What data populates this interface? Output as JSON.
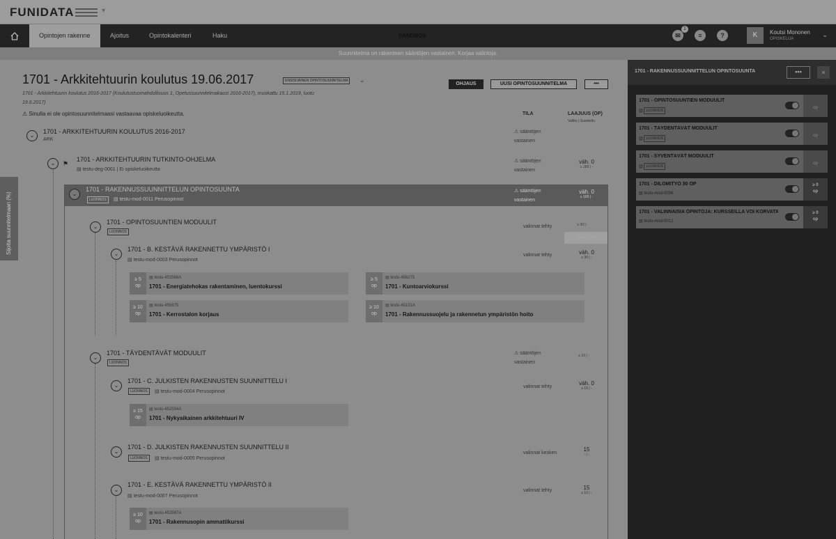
{
  "brand": {
    "logo": "FUNIDATA"
  },
  "nav": {
    "tabs": [
      "Opintojen rakenne",
      "Ajoitus",
      "Opintokalenteri",
      "Haku"
    ],
    "environment": "SANDBOX",
    "notification_count": "1",
    "user": {
      "initial": "K",
      "name": "Koutsi Mononen",
      "role": "OPISKELIJA"
    }
  },
  "notice": "Suunnitelma on rakenteen sääntöjen vastainen. Korjaa valintoja.",
  "plan": {
    "title": "1701 - Arkkitehtuurin koulutus 19.06.2017",
    "primary_tag": "ENSISIJAINEN OPINTOSUUNNITELMA",
    "subtitle": "1701 - Arkkitehtuurin koulutus 2016-2017 (Koulutustuomahdollisuus 1, Opetussuunnitelmakausi 2016-2017), muokattu 15.1.2019, luotu 19.6.2017)",
    "warning": "Sinulla ei ole opintosuunnitelmaasi vastaavaa opiskeluoikeutta.",
    "buttons": {
      "guidance": "OHJAUS",
      "new_plan": "UUSI OPINTOSUUNNITELMA",
      "more": "•••"
    },
    "columns": {
      "status": "TILA",
      "credits": "LAAJUUS (OP)",
      "credits_sub": "Valittu | Suoritettu"
    }
  },
  "tree": {
    "education": {
      "title": "1701 - ARKKITEHTUURIN KOULUTUS 2016-2017",
      "code": "ARK",
      "status": "sääntöjen vastainen"
    },
    "programme": {
      "title": "1701 - ARKKITEHTUURIN TUTKINTO-OHJELMA",
      "meta": "testu-deg-0001 | Ei opiskeluoikeutta",
      "status": "sääntöjen vastainen",
      "credit": "väh. 0",
      "credit_sub": "≥ 180 | -"
    },
    "track": {
      "title": "1701 - RAKENNUSSUUNNITTELUN OPINTOSUUNTA",
      "tag": "LUONNOS",
      "meta": "testu-mod-0011 Perusopinnot",
      "status": "sääntöjen vastainen",
      "credit": "väh. 0",
      "credit_sub": "≥ 100 | -"
    },
    "module1": {
      "title": "1701 - OPINTOSUUNTIEN MODUULIT",
      "tag": "LUONNOS",
      "status": "valinnat tehty",
      "credit_sub": "≥ 30 | -",
      "drop": "Lisää ≥ 30"
    },
    "module1a": {
      "title": "1701 - B. KESTÄVÄ RAKENNETTU YMPÄRISTÖ I",
      "meta": "testu-mod-0003 Perusopinnot",
      "status": "valinnat tehty",
      "credit": "väh. 0",
      "credit_sub": "≥ 30 | -"
    },
    "courses1": [
      {
        "credit": "≥ 5",
        "unit": "op",
        "code": "testu-453568A",
        "name": "1701 - Energiatehokas rakentaminen, luentokurssi"
      },
      {
        "credit": "≥ 5",
        "unit": "op",
        "code": "testu-456275",
        "name": "1701 - Kuntoarviokurssi"
      },
      {
        "credit": "≥ 10",
        "unit": "op",
        "code": "testu-455675",
        "name": "1701 - Kerrostalon korjaus"
      },
      {
        "credit": "≥ 10",
        "unit": "op",
        "code": "testu-45151A",
        "name": "1701 - Rakennussuojelu ja rakennetun ympäristön hoito"
      }
    ],
    "module2": {
      "title": "1701 - TÄYDENTÄVÄT MODUULIT",
      "tag": "LUONNOS",
      "status": "sääntöjen vastainen",
      "credit_sub": "≥ 10 | -"
    },
    "module2a": {
      "title": "1701 - C. JULKISTEN RAKENNUSTEN SUUNNITTELU I",
      "tag": "LUONNOS",
      "meta": "testu-mod-0004 Perusopinnot",
      "status": "valinnat tehty",
      "credit": "väh. 0",
      "credit_sub": "≥ 15 | -"
    },
    "courses2": [
      {
        "credit": "≥ 15",
        "unit": "op",
        "code": "testu-452504A",
        "name": "1701 - Nykyaikainen arkkitehtuuri IV"
      }
    ],
    "module2b": {
      "title": "1701 - D. JULKISTEN RAKENNUSTEN SUUNNITTELU II",
      "tag": "LUONNOS",
      "meta": "testu-mod-0005 Perusopinnot",
      "status": "valinnat kesken",
      "credit": "15",
      "credit_sub": "- | -"
    },
    "module2c": {
      "title": "1701 - E. KESTÄVÄ RAKENNETTU YMPÄRISTÖ II",
      "meta": "testu-mod-0007 Perusopinnot",
      "status": "valinnat tehty",
      "credit": "15",
      "credit_sub": "≥ 10 | -"
    },
    "courses3": [
      {
        "credit": "≥ 10",
        "unit": "op",
        "code": "testu-453567A",
        "name": "1701 - Rakennusopin ammattikurssi"
      }
    ]
  },
  "side_tab": "Sijoita suunnitelmaan (%)",
  "panel": {
    "title": "1701 - RAKENNUSSUUNNITTELUN OPINTOSUUNTA",
    "more": "•••",
    "close": "×",
    "cards": [
      {
        "title": "1701 - OPINTOSUUNTIEN MODUULIT",
        "tag": "LUONNOS",
        "meta": "",
        "credit": "",
        "unit": "op"
      },
      {
        "title": "1701 - TÄYDENTÄVÄT MODUULIT",
        "tag": "LUONNOS",
        "meta": "",
        "credit": "",
        "unit": "op"
      },
      {
        "title": "1701 - SYVENTÄVÄT MODUULIT",
        "tag": "LUONNOS",
        "meta": "",
        "credit": "",
        "unit": "op"
      },
      {
        "title": "1701 - DILOMITYÖ 30 OP",
        "tag": "",
        "meta": "testu-mod-0006",
        "credit": "≥ 0",
        "unit": "op"
      },
      {
        "title": "1701 - VALINNAISIA OPINTOJA: KURSSEILLA VOI KORVATA",
        "tag": "",
        "meta": "testu-mod-0012",
        "credit": "≥ 0",
        "unit": "op"
      }
    ]
  }
}
